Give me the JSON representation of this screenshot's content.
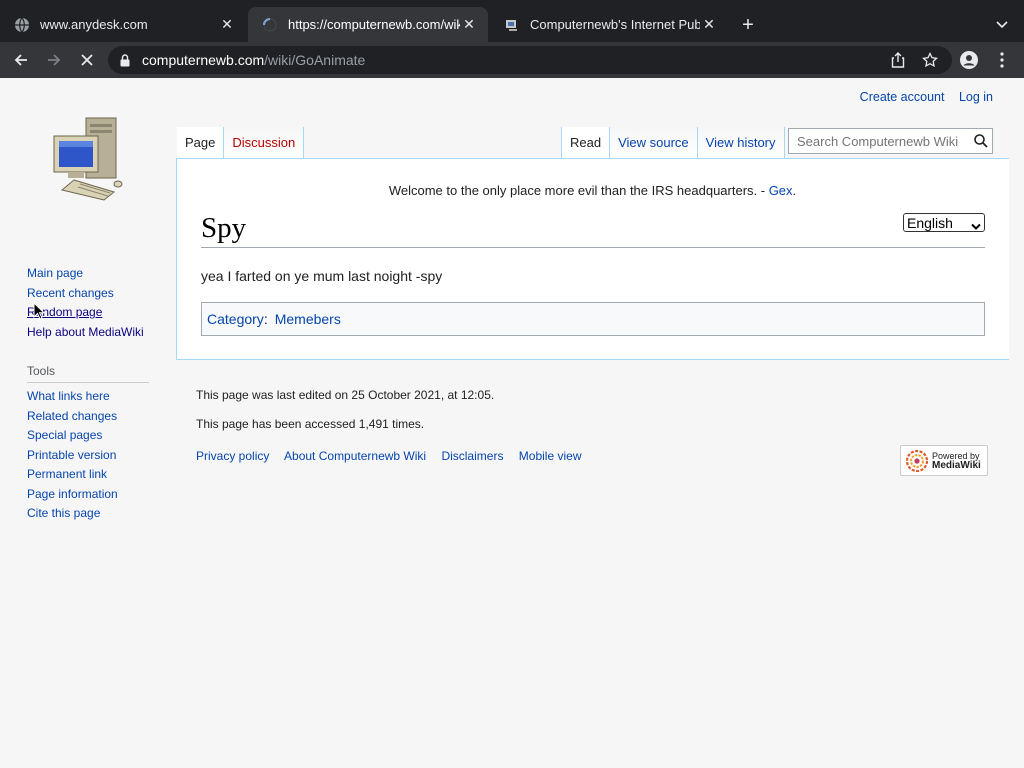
{
  "browser": {
    "tabs": [
      {
        "title": "www.anydesk.com",
        "favicon": "globe-icon"
      },
      {
        "title": "https://computernewb.com/wiki",
        "favicon": "loading-spinner-icon"
      },
      {
        "title": "Computernewb's Internet Pub",
        "favicon": "site-icon"
      }
    ],
    "url_host": "computernewb.com",
    "url_path": "/wiki/GoAnimate"
  },
  "personal": {
    "create_account": "Create account",
    "log_in": "Log in"
  },
  "tabs": {
    "page": "Page",
    "discussion": "Discussion",
    "read": "Read",
    "view_source": "View source",
    "view_history": "View history"
  },
  "search": {
    "placeholder": "Search Computernewb Wiki"
  },
  "sidebar": {
    "nav": [
      "Main page",
      "Recent changes",
      "Random page",
      "Help about MediaWiki"
    ],
    "tools_heading": "Tools",
    "tools": [
      "What links here",
      "Related changes",
      "Special pages",
      "Printable version",
      "Permanent link",
      "Page information",
      "Cite this page"
    ]
  },
  "sitenotice": {
    "text": "Welcome to the only place more evil than the IRS headquarters. - ",
    "link": "Gex",
    "end": "."
  },
  "language": {
    "selected": "English"
  },
  "article": {
    "title": "Spy",
    "body": "yea I farted on ye mum last noight -spy",
    "category_label": "Category",
    "category_sep": ":",
    "category": "Memebers"
  },
  "footer": {
    "last_edited": "This page was last edited on 25 October 2021, at 12:05.",
    "accessed": "This page has been accessed 1,491 times.",
    "links": [
      "Privacy policy",
      "About Computernewb Wiki",
      "Disclaimers",
      "Mobile view"
    ],
    "powered_line1": "Powered by",
    "powered_line2": "MediaWiki"
  }
}
